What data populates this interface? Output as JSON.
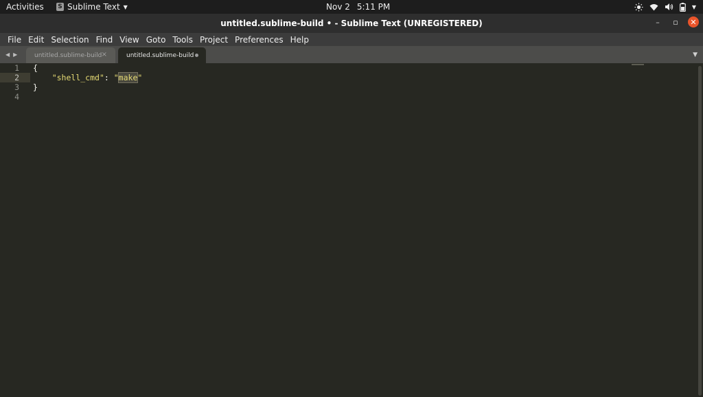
{
  "topbar": {
    "activities": "Activities",
    "app_name": "Sublime Text",
    "date": "Nov 2",
    "time": "5:11 PM",
    "tray_icons": [
      "brightness-icon",
      "wifi-icon",
      "volume-icon",
      "battery-icon",
      "system-menu-caret-icon"
    ]
  },
  "window": {
    "title": "untitled.sublime-build • - Sublime Text (UNREGISTERED)",
    "controls": {
      "minimize": "–",
      "restore": "▫",
      "close": "✕"
    }
  },
  "menu": [
    "File",
    "Edit",
    "Selection",
    "Find",
    "View",
    "Goto",
    "Tools",
    "Project",
    "Preferences",
    "Help"
  ],
  "tabs": [
    {
      "label": "untitled.sublime-build",
      "active": false,
      "close": "×"
    },
    {
      "label": "untitled.sublime-build",
      "active": true
    }
  ],
  "editor": {
    "line_numbers": [
      "1",
      "2",
      "3",
      "4"
    ],
    "current_line": 2,
    "lines": {
      "l1": "{",
      "l2_indent": "    ",
      "l2_key": "\"shell_cmd\"",
      "l2_colon": ": ",
      "l2_q1": "\"",
      "l2_value": "make",
      "l2_q2": "\"",
      "l3": "}",
      "l4": ""
    }
  },
  "colors": {
    "background": "#272822",
    "string": "#e6db74",
    "foreground": "#f8f8f2",
    "close_button": "#e9542a"
  }
}
